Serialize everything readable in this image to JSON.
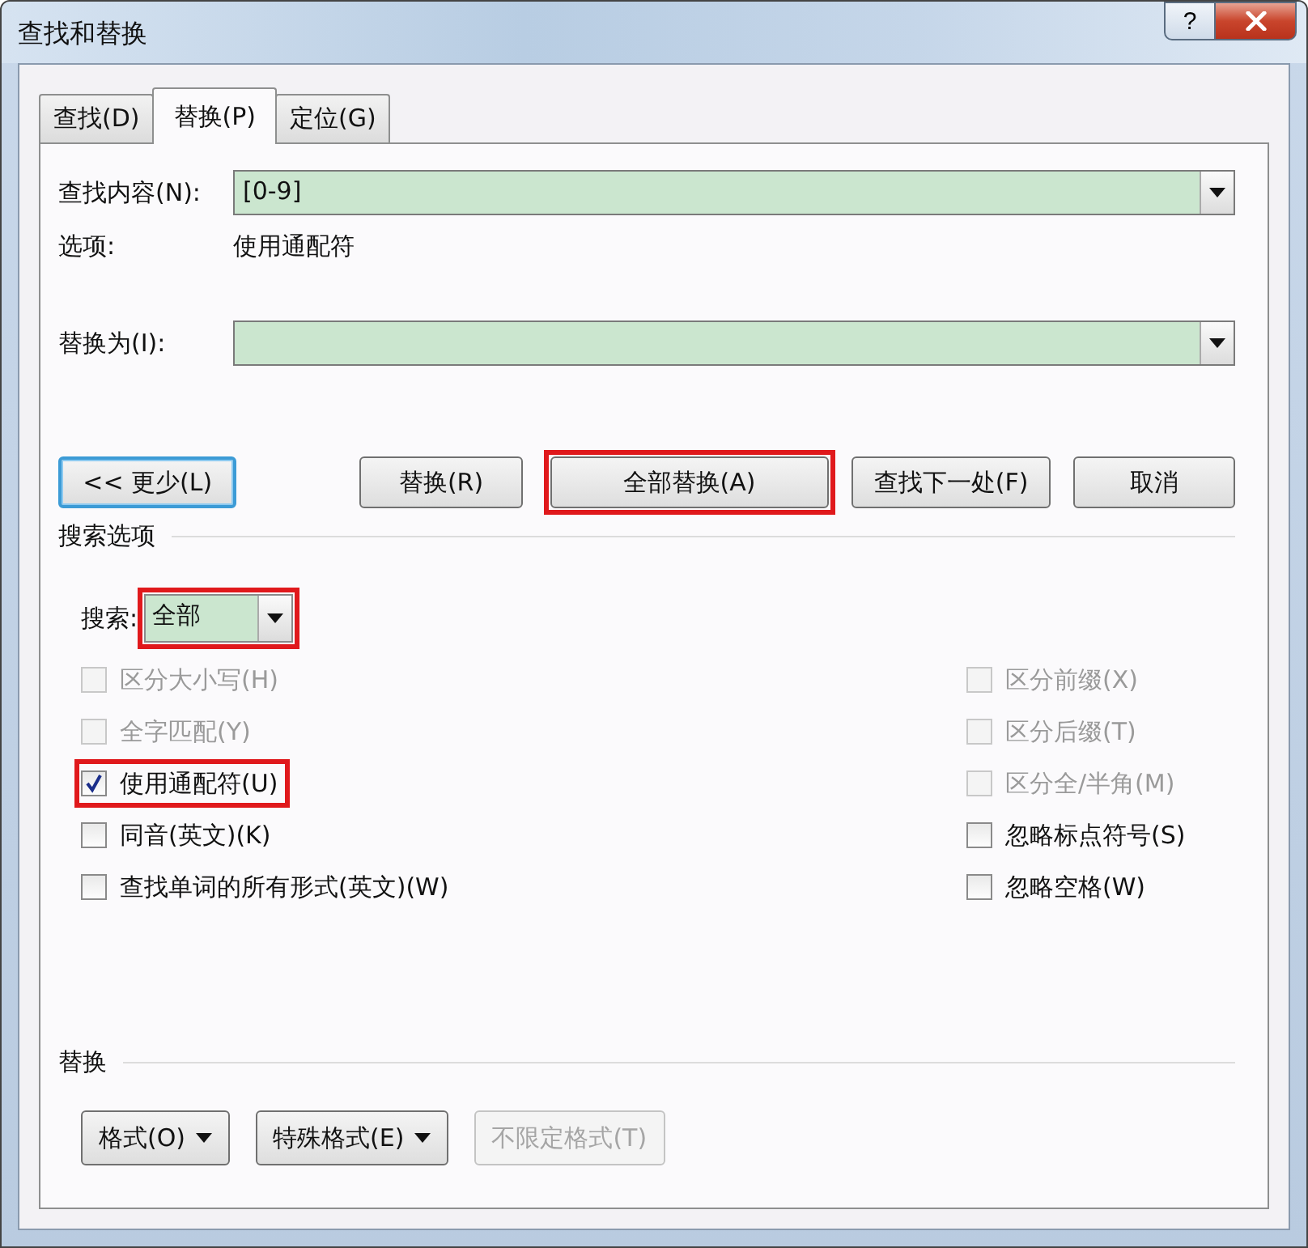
{
  "window": {
    "title": "查找和替换",
    "help_button": "?"
  },
  "tabs": [
    {
      "label": "查找(D)",
      "selected": false
    },
    {
      "label": "替换(P)",
      "selected": true
    },
    {
      "label": "定位(G)",
      "selected": false
    }
  ],
  "find": {
    "label": "查找内容(N):",
    "value": "[0-9]"
  },
  "options": {
    "label": "选项:",
    "value": "使用通配符"
  },
  "replace": {
    "label": "替换为(I):"
  },
  "buttons": [
    {
      "label": "<< 更少(L)",
      "focused": true,
      "highlighted": false
    },
    {
      "label": "替换(R)",
      "focused": false,
      "highlighted": false
    },
    {
      "label": "全部替换(A)",
      "focused": false,
      "highlighted": true
    },
    {
      "label": "查找下一处(F)",
      "focused": false,
      "highlighted": false
    },
    {
      "label": "取消",
      "focused": false,
      "highlighted": false
    }
  ],
  "search_options": {
    "title": "搜索选项",
    "search": {
      "label": "搜索:",
      "value": "全部",
      "highlighted": true
    },
    "left": [
      {
        "label": "区分大小写(H)",
        "checked": false,
        "disabled": true,
        "highlighted": false
      },
      {
        "label": "全字匹配(Y)",
        "checked": false,
        "disabled": true,
        "highlighted": false
      },
      {
        "label": "使用通配符(U)",
        "checked": true,
        "disabled": false,
        "highlighted": true
      },
      {
        "label": "同音(英文)(K)",
        "checked": false,
        "disabled": false,
        "highlighted": false
      },
      {
        "label": "查找单词的所有形式(英文)(W)",
        "checked": false,
        "disabled": false,
        "highlighted": false
      }
    ],
    "right": [
      {
        "label": "区分前缀(X)",
        "checked": false,
        "disabled": true,
        "highlighted": false
      },
      {
        "label": "区分后缀(T)",
        "checked": false,
        "disabled": true,
        "highlighted": false
      },
      {
        "label": "区分全/半角(M)",
        "checked": false,
        "disabled": true,
        "highlighted": false
      },
      {
        "label": "忽略标点符号(S)",
        "checked": false,
        "disabled": false,
        "highlighted": false
      },
      {
        "label": "忽略空格(W)",
        "checked": false,
        "disabled": false,
        "highlighted": false
      }
    ]
  },
  "replace_section": {
    "title": "替换",
    "buttons": [
      {
        "label": "格式(O)",
        "dropdown": true,
        "disabled": false
      },
      {
        "label": "特殊格式(E)",
        "dropdown": true,
        "disabled": false
      },
      {
        "label": "不限定格式(T)",
        "dropdown": false,
        "disabled": true
      }
    ]
  }
}
